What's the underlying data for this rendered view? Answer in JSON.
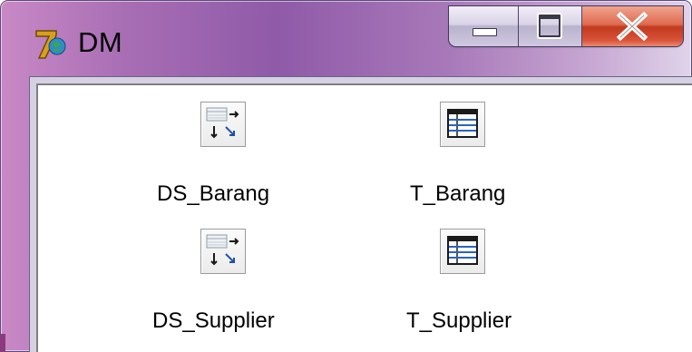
{
  "window": {
    "title": "DM",
    "app_icon": "delphi-app-icon",
    "controls": {
      "minimize_icon": "minimize-icon",
      "maximize_icon": "maximize-icon",
      "close_icon": "close-icon"
    }
  },
  "components": [
    {
      "label": "DS_Barang",
      "icon": "datasource-icon"
    },
    {
      "label": "T_Barang",
      "icon": "table-icon"
    },
    {
      "label": "DS_Supplier",
      "icon": "datasource-icon"
    },
    {
      "label": "T_Supplier",
      "icon": "table-icon"
    }
  ],
  "colors": {
    "close_button": "#c9472d",
    "canvas_background": "#ffffff",
    "window_frame": "#a070b4"
  }
}
